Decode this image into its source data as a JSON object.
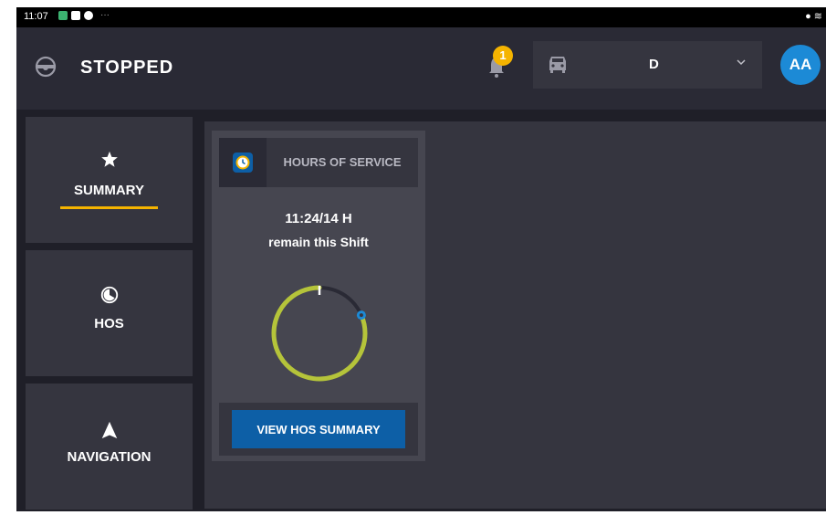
{
  "status_bar": {
    "time": "11:07",
    "more": "···"
  },
  "app_bar": {
    "title": "STOPPED",
    "notification_count": "1",
    "vehicle_selector": {
      "value": "D"
    },
    "avatar_initials": "AA"
  },
  "sidebar": {
    "items": [
      {
        "label": "SUMMARY",
        "icon": "star-icon",
        "active": true
      },
      {
        "label": "HOS",
        "icon": "clock-icon",
        "active": false
      },
      {
        "label": "NAVIGATION",
        "icon": "navigation-arrow-icon",
        "active": false
      }
    ]
  },
  "hos_card": {
    "title": "HOURS OF SERVICE",
    "hours_remaining": "11:24/14  H",
    "remain_label": "remain this Shift",
    "shift_remaining_fraction": 0.815,
    "button_label": "VIEW HOS SUMMARY"
  },
  "colors": {
    "accent_yellow": "#f5b400",
    "gauge_green": "#b5c43a",
    "gauge_marker_blue": "#1c8ad6",
    "button_blue": "#0d5fa6",
    "avatar_blue": "#1c8ad6"
  }
}
